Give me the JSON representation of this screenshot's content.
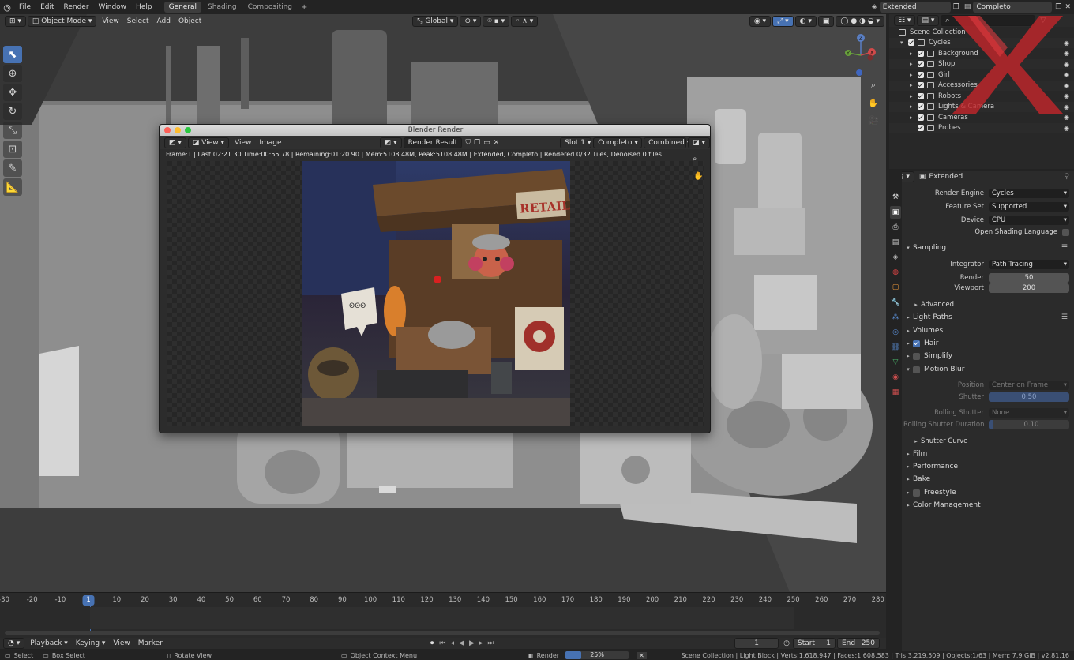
{
  "app": {
    "menu": [
      "File",
      "Edit",
      "Render",
      "Window",
      "Help"
    ],
    "workspaces": [
      "General",
      "Shading",
      "Compositing"
    ],
    "active_workspace": "General",
    "scene_name": "Extended",
    "view_layer": "Completo"
  },
  "viewport": {
    "mode": "Object Mode",
    "menus": [
      "View",
      "Select",
      "Add",
      "Object"
    ],
    "orientation": "Global",
    "gizmo_axes": [
      "Z",
      "Y",
      "X"
    ]
  },
  "render_window": {
    "title": "Blender Render",
    "menus": [
      "View",
      "View",
      "Image"
    ],
    "image_name": "Render Result",
    "slot": "Slot 1",
    "layer": "Completo",
    "pass": "Combined",
    "status": "Frame:1 | Last:02:21.30 Time:00:55.78 | Remaining:01:20.90 | Mem:5108.48M, Peak:5108.48M | Extended, Completo | Rendered 0/32 Tiles, Denoised 0 tiles",
    "sign_text": "RETAIL"
  },
  "outliner": {
    "root": "Scene Collection",
    "items": [
      {
        "name": "Cycles",
        "level": 1
      },
      {
        "name": "Background",
        "level": 2
      },
      {
        "name": "Shop",
        "level": 2
      },
      {
        "name": "Girl",
        "level": 2
      },
      {
        "name": "Accessories",
        "level": 2
      },
      {
        "name": "Robots",
        "level": 2
      },
      {
        "name": "Lights & Camera",
        "level": 2
      },
      {
        "name": "Cameras",
        "level": 2
      },
      {
        "name": "Probes",
        "level": 2
      }
    ]
  },
  "properties": {
    "context": "Extended",
    "render_engine_label": "Render Engine",
    "render_engine": "Cycles",
    "feature_set_label": "Feature Set",
    "feature_set": "Supported",
    "device_label": "Device",
    "device": "CPU",
    "osl_label": "Open Shading Language",
    "sampling": "Sampling",
    "integrator_label": "Integrator",
    "integrator": "Path Tracing",
    "render_label": "Render",
    "render_samples": "50",
    "viewport_label": "Viewport",
    "viewport_samples": "200",
    "advanced": "Advanced",
    "light_paths": "Light Paths",
    "volumes": "Volumes",
    "hair": "Hair",
    "simplify": "Simplify",
    "motion_blur": "Motion Blur",
    "position_label": "Position",
    "position": "Center on Frame",
    "shutter_label": "Shutter",
    "shutter": "0.50",
    "rolling_shutter_label": "Rolling Shutter",
    "rolling_shutter": "None",
    "rolling_duration_label": "Rolling Shutter Duration",
    "rolling_duration": "0.10",
    "shutter_curve": "Shutter Curve",
    "film": "Film",
    "performance": "Performance",
    "bake": "Bake",
    "freestyle": "Freestyle",
    "color_management": "Color Management"
  },
  "timeline": {
    "ticks": [
      "-30",
      "-20",
      "-10",
      "1",
      "10",
      "20",
      "30",
      "40",
      "50",
      "60",
      "70",
      "80",
      "90",
      "100",
      "110",
      "120",
      "130",
      "140",
      "150",
      "160",
      "170",
      "180",
      "190",
      "200",
      "210",
      "220",
      "230",
      "240",
      "250",
      "260",
      "270",
      "280"
    ],
    "current_frame": "1",
    "menus": [
      "Playback",
      "Keying",
      "View",
      "Marker"
    ],
    "frame_field": "1",
    "start_label": "Start",
    "start": "1",
    "end_label": "End",
    "end": "250"
  },
  "statusbar": {
    "select": "Select",
    "box_select": "Box Select",
    "rotate_view": "Rotate View",
    "context_menu": "Object Context Menu",
    "render_label": "Render",
    "render_progress": "25%",
    "render_fraction": 0.25,
    "stats": "Scene Collection | Light Block | Verts:1,618,947 | Faces:1,608,583 | Tris:3,219,509 | Objects:1/63 | Mem: 7.9 GiB | v2.81.16"
  },
  "colors": {
    "accent": "#4772b3",
    "bg_dark": "#232323",
    "viewport": "#3b3b3b"
  }
}
